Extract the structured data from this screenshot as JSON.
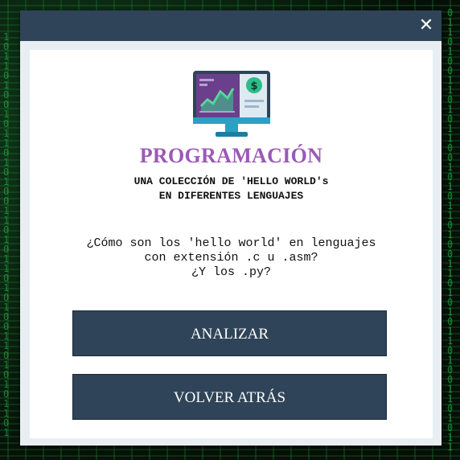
{
  "dialog": {
    "close_label": "✕",
    "heading": "PROGRAMACIÓN",
    "subtitle_line1": "UNA COLECCIÓN DE 'HELLO WORLD's",
    "subtitle_line2": "EN DIFERENTES LENGUAJES",
    "question_line1": "¿Cómo son los 'hello world' en lenguajes",
    "question_line2": "con extensión .c u .asm?",
    "question_line3": "¿Y los .py?",
    "analyze_label": "ANALIZAR",
    "back_label": "VOLVER ATRÁS",
    "logo_icon": "monitor-chart-dollar-icon"
  },
  "colors": {
    "titlebar": "#2f4458",
    "heading": "#9b59b6",
    "button": "#2f4458",
    "panel": "#ffffff",
    "frame": "#e8eef2"
  }
}
